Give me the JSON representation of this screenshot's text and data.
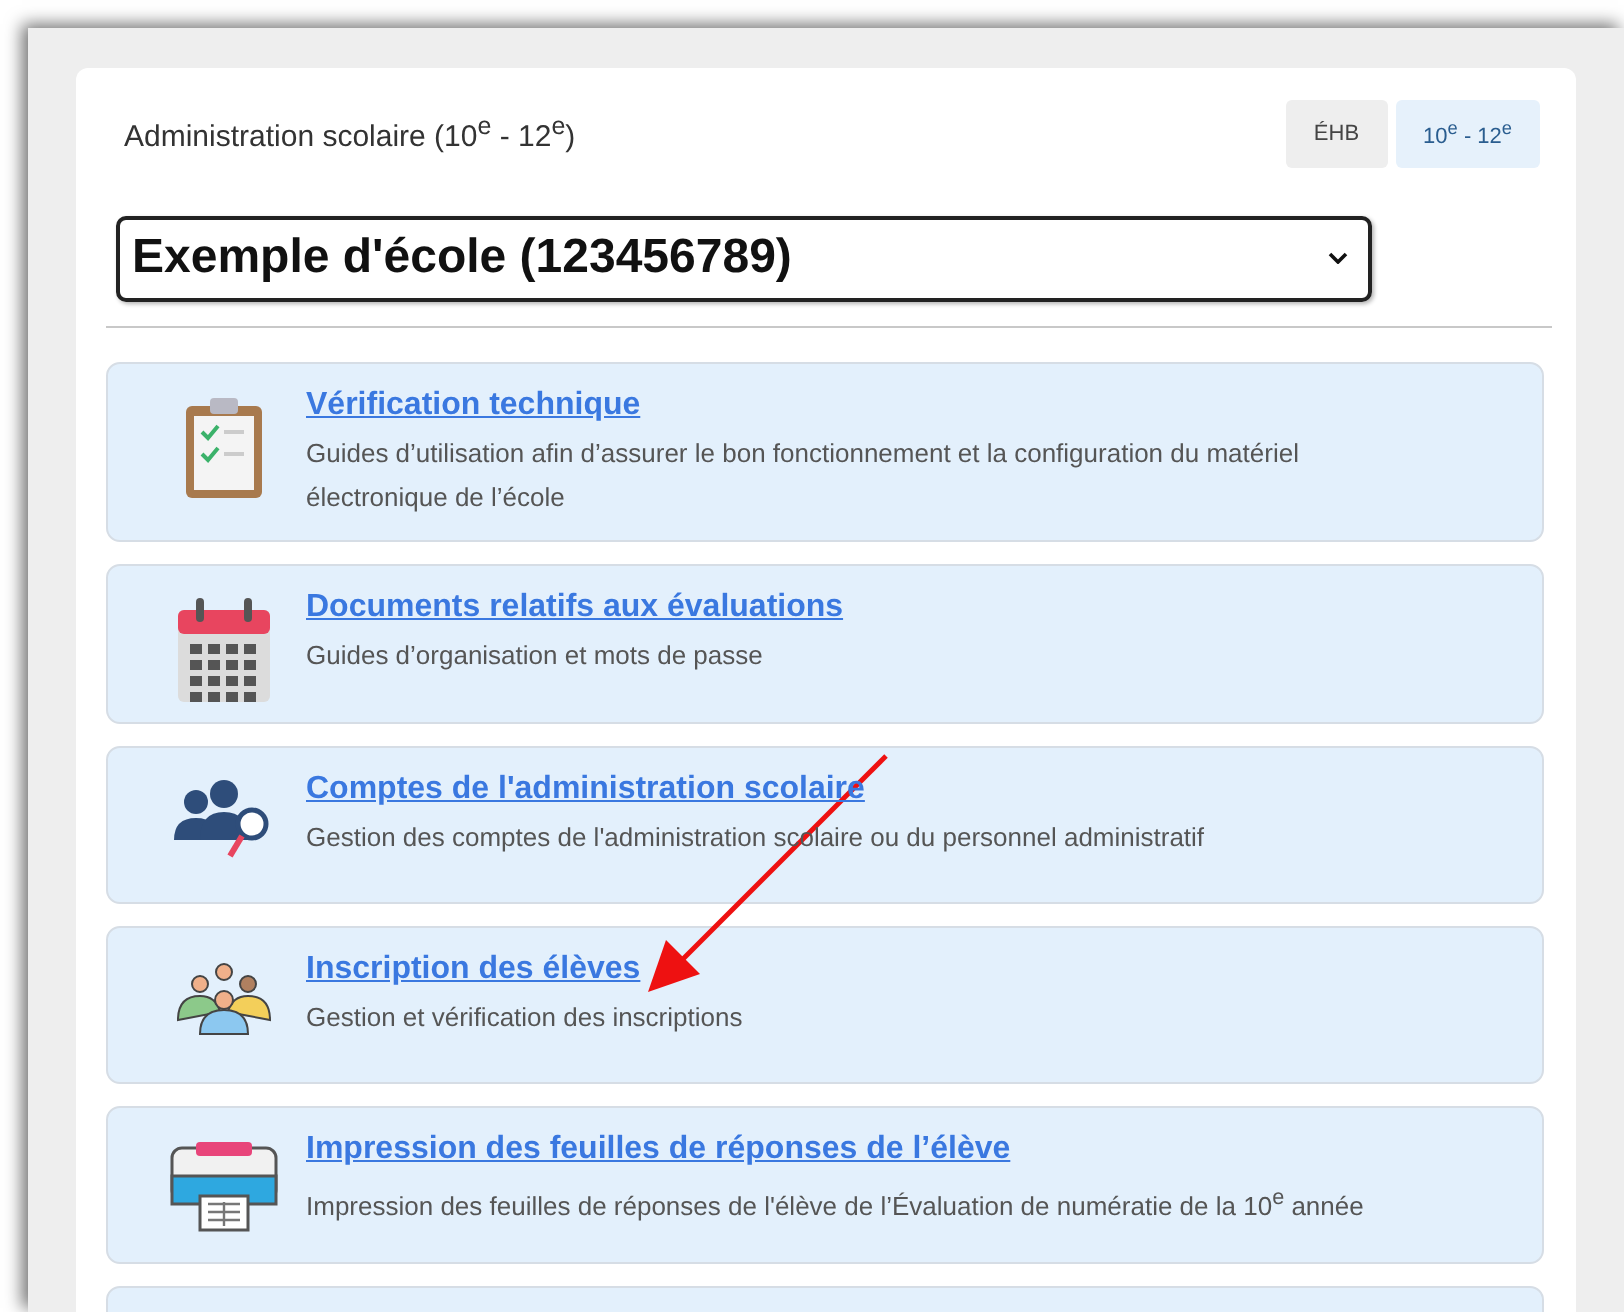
{
  "header": {
    "title": "Administration scolaire (10$^{e}$ - 12$^{e}$)"
  },
  "tabs": [
    {
      "label": "ÉHB",
      "selected": false
    },
    {
      "label": "10$^{e}$ - 12$^{e}$",
      "selected": true
    }
  ],
  "school_select": {
    "value": "Exemple d'école (123456789)"
  },
  "items": [
    {
      "title": "Vérification technique",
      "description": "Guides d’utilisation afin d’assurer le bon fonctionnement et la configuration du matériel électronique de l’école"
    },
    {
      "title": "Documents relatifs aux évaluations",
      "description": "Guides d’organisation et mots de passe"
    },
    {
      "title": "Comptes de l'administration scolaire",
      "description": "Gestion des comptes de l'administration scolaire ou du personnel administratif"
    },
    {
      "title": "Inscription des élèves",
      "description": "Gestion et vérification des inscriptions"
    },
    {
      "title": "Impression des feuilles de réponses de l’élève",
      "description": "Impression des feuilles de réponses de l'élève de l’Évaluation de numératie de la 10$^{e}$ année"
    }
  ]
}
